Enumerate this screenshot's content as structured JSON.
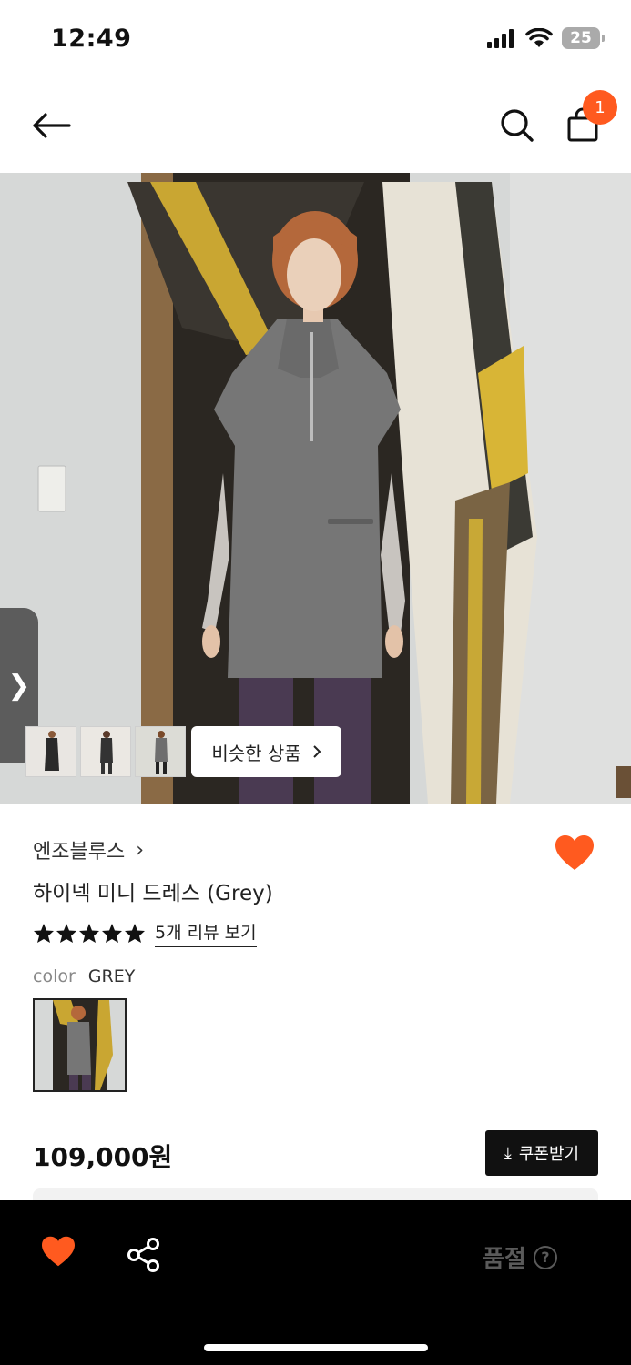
{
  "status_bar": {
    "time": "12:49",
    "battery": "25"
  },
  "header": {
    "cart_count": "1",
    "icons": [
      "back-arrow-icon",
      "search-icon",
      "shopping-bag-icon"
    ]
  },
  "gallery": {
    "similar_label": "비슷한 상품",
    "side_tab_glyph": "❯"
  },
  "product": {
    "brand": "엔조블루스",
    "brand_chevron": "›",
    "name": "하이넥 미니 드레스 (Grey)",
    "rating": 5,
    "review_link": "5개 리뷰 보기",
    "color_label": "color",
    "color_value": "GREY",
    "price": "109,000원",
    "coupon_label": "쿠폰받기",
    "coupon_glyph": "⤓"
  },
  "bottom_bar": {
    "soldout_label": "품절",
    "help_glyph": "?"
  },
  "colors": {
    "accent": "#ff5a1f",
    "dark": "#111111",
    "bar": "#000000",
    "muted": "#5a5a5a"
  }
}
